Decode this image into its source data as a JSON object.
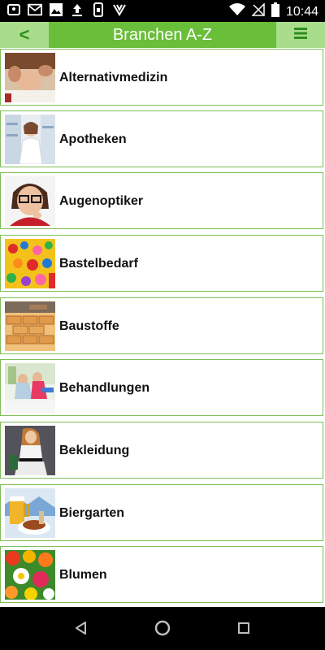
{
  "status_bar": {
    "time": "10:44",
    "left_icons": [
      "location-card-icon",
      "gmail-icon",
      "image-icon",
      "upload-icon",
      "phone-icon",
      "app-icon"
    ],
    "right_icons": [
      "wifi-icon",
      "no-signal-icon",
      "battery-icon"
    ]
  },
  "app_bar": {
    "title": "Branchen A-Z",
    "back_label": "<",
    "menu_icon": "menu-icon",
    "color": "#6abf3a",
    "button_color": "#a9dd8b"
  },
  "categories": [
    {
      "label": "Alternativmedizin",
      "icon": "massage-photo"
    },
    {
      "label": "Apotheken",
      "icon": "pharmacist-photo"
    },
    {
      "label": "Augenoptiker",
      "icon": "glasses-photo"
    },
    {
      "label": "Bastelbedarf",
      "icon": "craft-supplies-photo"
    },
    {
      "label": "Baustoffe",
      "icon": "bricks-photo"
    },
    {
      "label": "Behandlungen",
      "icon": "treatment-photo"
    },
    {
      "label": "Bekleidung",
      "icon": "fashion-photo"
    },
    {
      "label": "Biergarten",
      "icon": "beer-food-photo"
    },
    {
      "label": "Blumen",
      "icon": "flowers-photo"
    }
  ],
  "nav_bar": {
    "icons": [
      "back-triangle-icon",
      "home-circle-icon",
      "recents-square-icon"
    ]
  }
}
